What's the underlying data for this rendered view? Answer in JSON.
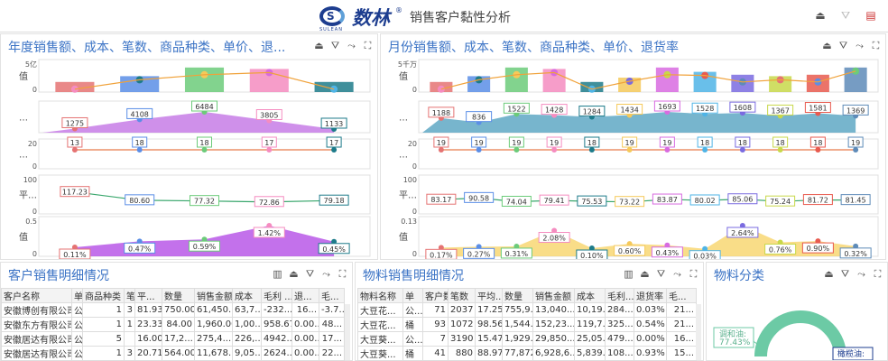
{
  "header": {
    "brand": "数林",
    "brand_sub": "SULEAN",
    "reg": "®",
    "title": "销售客户黏性分析"
  },
  "year_panel": {
    "title": "年度销售额、成本、笔数、商品种类、单价、退...",
    "ylabels": [
      "值",
      "…",
      "…",
      "平…",
      "值"
    ],
    "ticks": {
      "r1": [
        "5亿",
        "0"
      ],
      "r3": [
        "20",
        "0"
      ],
      "r4": [
        "100",
        "0"
      ],
      "r5": [
        "0.5",
        "0"
      ]
    },
    "r2_labels": [
      "1275",
      "4108",
      "6484",
      "3805",
      "1133"
    ],
    "r3_labels": [
      "13",
      "18",
      "18",
      "17",
      "17"
    ],
    "r4_labels": [
      "117.23",
      "80.60",
      "77.32",
      "72.86",
      "79.18"
    ],
    "r5_labels": [
      "0.11%",
      "0.47%",
      "0.59%",
      "1.42%",
      "0.45%"
    ]
  },
  "month_panel": {
    "title": "月份销售额、成本、笔数、商品种类、单价、退货率",
    "ylabels": [
      "值",
      "…",
      "…",
      "平…",
      "值"
    ],
    "ticks": {
      "r1": [
        "5千万",
        "0"
      ],
      "r3": [
        "20",
        "0"
      ],
      "r4": [
        "100",
        "0"
      ],
      "r5": [
        "0.13",
        "0"
      ]
    },
    "r2_labels": [
      "1188",
      "836",
      "1522",
      "1428",
      "1284",
      "1434",
      "1693",
      "1528",
      "1608",
      "1367",
      "1581",
      "1369"
    ],
    "r3_labels": [
      "19",
      "19",
      "19",
      "19",
      "18",
      "19",
      "19",
      "18",
      "18",
      "18",
      "18",
      "19"
    ],
    "r4_labels": [
      "83.17",
      "90.58",
      "74.04",
      "79.41",
      "75.53",
      "73.22",
      "83.87",
      "80.02",
      "85.06",
      "75.24",
      "81.72",
      "81.45"
    ],
    "r5_labels": [
      "0.17%",
      "0.27%",
      "0.31%",
      "2.08%",
      "0.10%",
      "0.60%",
      "0.43%",
      "0.03%",
      "2.64%",
      "0.76%",
      "0.90%",
      "0.32%"
    ]
  },
  "customer_panel": {
    "title": "客户销售明细情况",
    "columns": [
      "客户名称",
      "单",
      "商品种类",
      "笔",
      "平...",
      "数量",
      "销售金额",
      "成本",
      "毛利 ...",
      "退...",
      "毛..."
    ],
    "rows": [
      [
        "安徽博创有限公司",
        "公",
        "1",
        "3",
        "81.93",
        "750.00",
        "61,450...",
        "63,7...",
        "-232...",
        "16...",
        "-3.7..."
      ],
      [
        "安徽东方有限公司",
        "公",
        "1",
        "1",
        "23.33",
        "84.00",
        "1,960.00",
        "1,00...",
        "958.67",
        "0.00...",
        "48..."
      ],
      [
        "安徽居达有限公司",
        "公",
        "5",
        "",
        "16.00",
        "17,2...",
        "275,4...",
        "226,...",
        "4942...",
        "0.00...",
        "17..."
      ],
      [
        "安徽居达有限公司",
        "公",
        "1",
        "3",
        "20.71",
        "564.00",
        "11,678...",
        "9,05...",
        "2624...",
        "0.00...",
        "22..."
      ]
    ]
  },
  "material_panel": {
    "title": "物料销售明细情况",
    "columns": [
      "物料名称",
      "单",
      "客户数",
      "笔数",
      "平均...",
      "数量",
      "销售金额",
      "成本",
      "毛利...",
      "退货率",
      "毛..."
    ],
    "rows": [
      [
        "大豆花...",
        "公...",
        "71",
        "2037",
        "17.25",
        "755,9...",
        "13,040...",
        "10,19...",
        "284...",
        "0.03%",
        "21..."
      ],
      [
        "大豆花...",
        "桶",
        "93",
        "1072",
        "98.56",
        "1,544...",
        "152,23...",
        "119,7...",
        "325...",
        "0.54%",
        "21..."
      ],
      [
        "大豆葵...",
        "公...",
        "7",
        "3190",
        "15.47",
        "1,929...",
        "29,850...",
        "25,05...",
        "479...",
        "0.00%",
        "16..."
      ],
      [
        "大豆葵...",
        "桶",
        "41",
        "880",
        "88.97",
        "77,872",
        "6,928,6...",
        "5,839...",
        "108...",
        "0.93%",
        "15..."
      ]
    ]
  },
  "category_panel": {
    "title": "物料分类",
    "slices": [
      {
        "name": "调和油",
        "pct": "77.43%"
      },
      {
        "name": "橄榄油",
        "pct": ""
      }
    ],
    "label1": "调和油:",
    "label1_val": "77.43%",
    "label2": "橄榄油:"
  },
  "colors": {
    "accent": "#3b73c5",
    "purple": "#b44de6",
    "yellow": "#f8d46a",
    "teal": "#5fa8c4"
  }
}
